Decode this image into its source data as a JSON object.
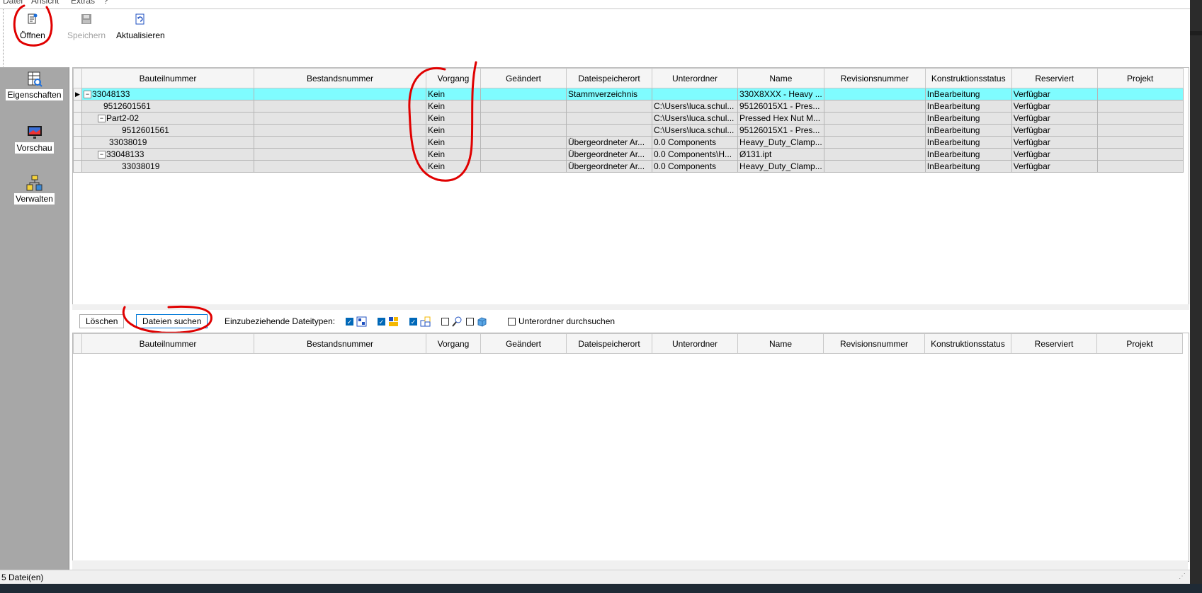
{
  "menubar": [
    "Datei",
    "Ansicht",
    "Extras",
    "?"
  ],
  "toolbar": {
    "open_label": "Öffnen",
    "save_label": "Speichern",
    "refresh_label": "Aktualisieren"
  },
  "sidebar": {
    "properties_label": "Eigenschaften",
    "preview_label": "Vorschau",
    "manage_label": "Verwalten"
  },
  "columns": [
    "Bauteilnummer",
    "Bestandsnummer",
    "Vorgang",
    "Geändert",
    "Dateispeicherort",
    "Unterordner",
    "Name",
    "Revisionsnummer",
    "Konstruktionsstatus",
    "Reserviert",
    "Projekt"
  ],
  "rows": [
    {
      "bauteil": "33048133",
      "bestand": "",
      "vorgang": "Kein",
      "geaendert": "",
      "speicherort": "Stammverzeichnis",
      "unterordner": "",
      "name": "330X8XXX - Heavy ...",
      "revision": "",
      "status": "InBearbeitung",
      "reserviert": "Verfügbar",
      "projekt": ""
    },
    {
      "bauteil": "9512601561",
      "bestand": "",
      "vorgang": "Kein",
      "geaendert": "",
      "speicherort": "",
      "unterordner": "C:\\Users\\luca.schul...",
      "name": "95126015X1 - Pres...",
      "revision": "",
      "status": "InBearbeitung",
      "reserviert": "Verfügbar",
      "projekt": ""
    },
    {
      "bauteil": "Part2-02",
      "bestand": "",
      "vorgang": "Kein",
      "geaendert": "",
      "speicherort": "",
      "unterordner": "C:\\Users\\luca.schul...",
      "name": "Pressed Hex Nut M...",
      "revision": "",
      "status": "InBearbeitung",
      "reserviert": "Verfügbar",
      "projekt": ""
    },
    {
      "bauteil": "9512601561",
      "bestand": "",
      "vorgang": "Kein",
      "geaendert": "",
      "speicherort": "",
      "unterordner": "C:\\Users\\luca.schul...",
      "name": "95126015X1 - Pres...",
      "revision": "",
      "status": "InBearbeitung",
      "reserviert": "Verfügbar",
      "projekt": ""
    },
    {
      "bauteil": "33038019",
      "bestand": "",
      "vorgang": "Kein",
      "geaendert": "",
      "speicherort": "Übergeordneter Ar...",
      "unterordner": "0.0 Components",
      "name": "Heavy_Duty_Clamp...",
      "revision": "",
      "status": "InBearbeitung",
      "reserviert": "Verfügbar",
      "projekt": ""
    },
    {
      "bauteil": "33048133",
      "bestand": "",
      "vorgang": "Kein",
      "geaendert": "",
      "speicherort": "Übergeordneter Ar...",
      "unterordner": "0.0 Components\\H...",
      "name": "Ø131.ipt",
      "revision": "",
      "status": "InBearbeitung",
      "reserviert": "Verfügbar",
      "projekt": ""
    },
    {
      "bauteil": "33038019",
      "bestand": "",
      "vorgang": "Kein",
      "geaendert": "",
      "speicherort": "Übergeordneter Ar...",
      "unterordner": "0.0 Components",
      "name": "Heavy_Duty_Clamp...",
      "revision": "",
      "status": "InBearbeitung",
      "reserviert": "Verfügbar",
      "projekt": ""
    }
  ],
  "filter": {
    "delete_label": "Löschen",
    "search_label": "Dateien suchen",
    "filetypes_label": "Einzubeziehende Dateitypen:",
    "subfolder_label": "Unterordner durchsuchen"
  },
  "status": {
    "file_count": "5 Datei(en)"
  },
  "colors": {
    "selected_row": "#7ffcff",
    "sidebar": "#a7a7a7",
    "annotation": "#e00000"
  }
}
